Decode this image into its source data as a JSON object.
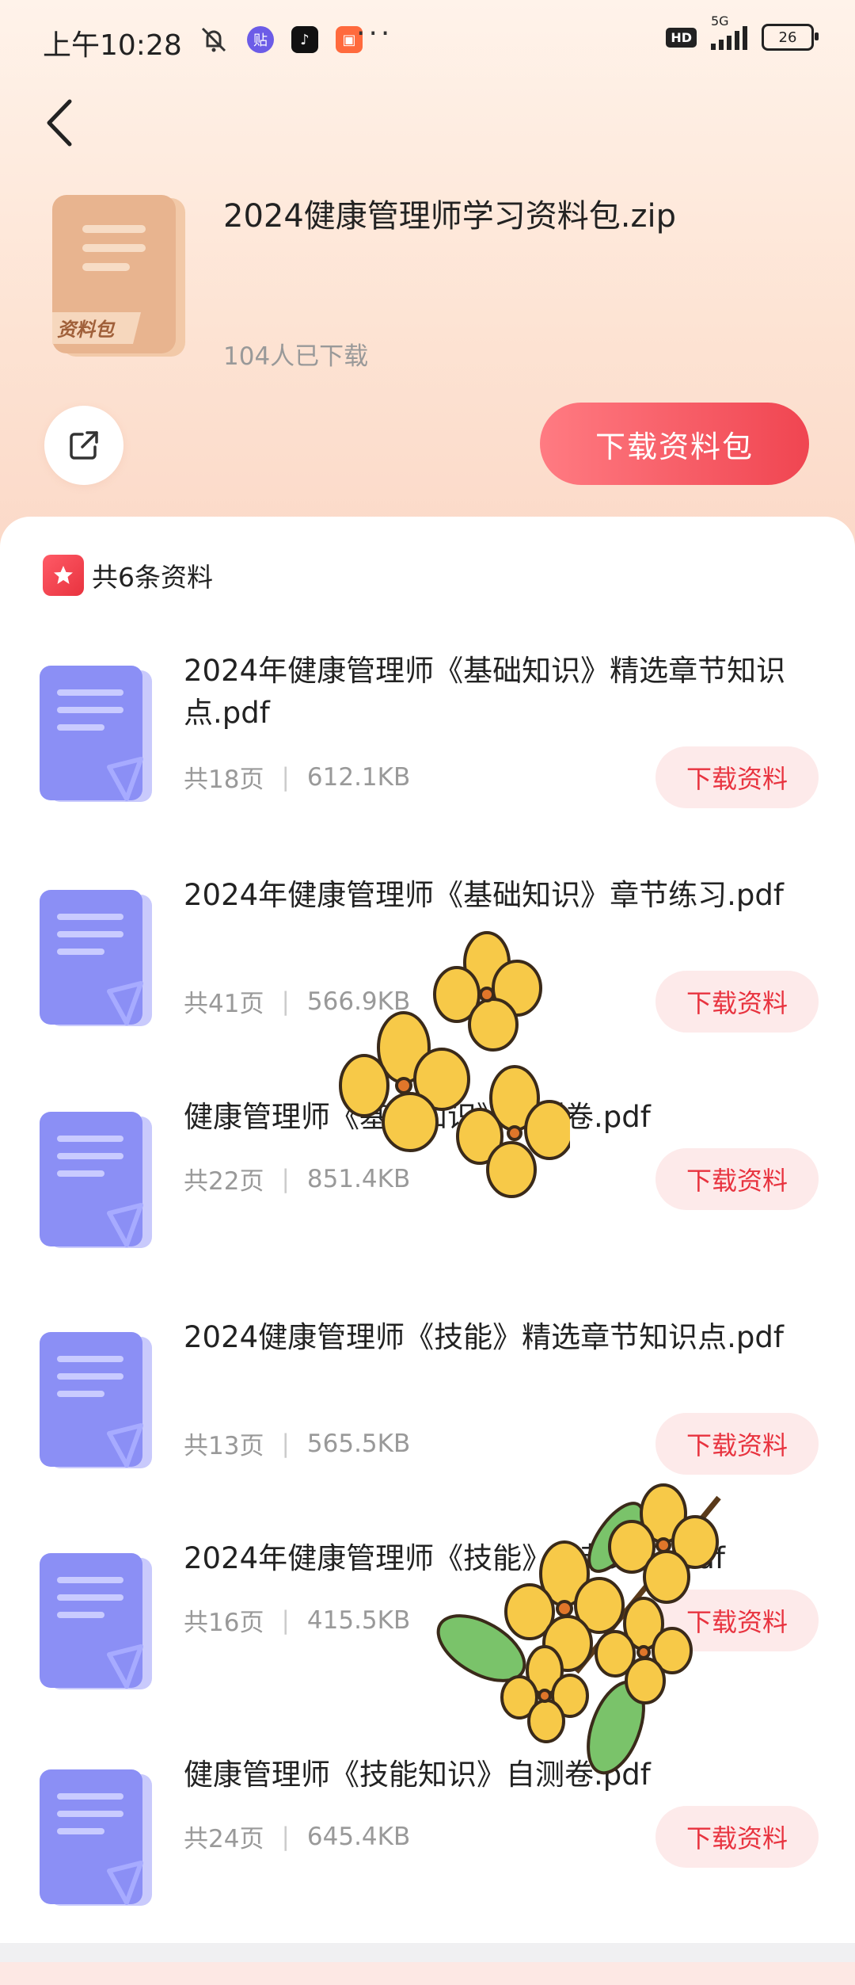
{
  "status_bar": {
    "time": "上午10:28",
    "battery": "26",
    "network": "5G",
    "hd": "HD",
    "more": "···"
  },
  "package": {
    "title": "2024健康管理师学习资料包.zip",
    "downloads": "104人已下载",
    "icon_label": "资料包",
    "download_button": "下载资料包"
  },
  "list": {
    "count_label": "共6条资料",
    "items": [
      {
        "name": "2024年健康管理师《基础知识》精选章节知识点.pdf",
        "pages": "共18页",
        "size": "612.1KB",
        "button": "下载资料"
      },
      {
        "name": "2024年健康管理师《基础知识》章节练习.pdf",
        "pages": "共41页",
        "size": "566.9KB",
        "button": "下载资料"
      },
      {
        "name": "健康管理师《基础知识》自测卷.pdf",
        "pages": "共22页",
        "size": "851.4KB",
        "button": "下载资料"
      },
      {
        "name": "2024健康管理师《技能》精选章节知识点.pdf",
        "pages": "共13页",
        "size": "565.5KB",
        "button": "下载资料"
      },
      {
        "name": "2024年健康管理师《技能》章节练习.pdf",
        "pages": "共16页",
        "size": "415.5KB",
        "button": "下载资料"
      },
      {
        "name": "健康管理师《技能知识》自测卷.pdf",
        "pages": "共24页",
        "size": "645.4KB",
        "button": "下载资料"
      }
    ]
  },
  "colors": {
    "accent": "#e8333f",
    "file_icon": "#8b8ff5"
  }
}
